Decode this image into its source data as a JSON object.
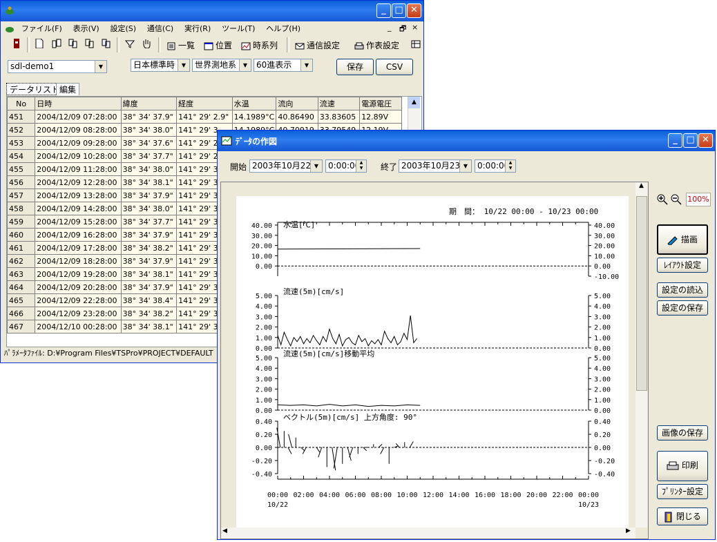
{
  "main": {
    "menu": [
      "ファイル(F)",
      "表示(V)",
      "設定(S)",
      "通信(C)",
      "実行(R)",
      "ツール(T)",
      "ヘルプ(H)"
    ],
    "mdi_controls": [
      "_",
      "🗗",
      "×"
    ],
    "toolbar": {
      "list_label": "一覧",
      "position_label": "位置",
      "timeseries_label": "時系列",
      "comm_settings_label": "通信設定",
      "table_settings_label": "作表設定"
    },
    "site_select": "sdl-demo1",
    "time_select": "日本標準時",
    "datum_select": "世界測地系",
    "format_select": "60進表示",
    "save_label": "保存",
    "csv_label": "CSV",
    "tabs": [
      "データリスト",
      "編集"
    ],
    "columns": [
      "No",
      "日時",
      "緯度",
      "経度",
      "水温",
      "流向",
      "流速",
      "電源電圧"
    ],
    "rows": [
      [
        "451",
        "2004/12/09 07:28:00",
        "38° 34' 37.9\"",
        "141° 29'  2.9\"",
        "14.1989°C",
        "40.86490",
        "33.83605",
        "12.89V"
      ],
      [
        "452",
        "2004/12/09 08:28:00",
        "38° 34' 38.0\"",
        "141° 29'  3.",
        "14.1989°C",
        "40.70919",
        "33.79549",
        "12.19V"
      ],
      [
        "453",
        "2004/12/09 09:28:00",
        "38° 34' 37.6\"",
        "141° 29'  2.",
        "",
        "",
        "",
        ""
      ],
      [
        "454",
        "2004/12/09 10:28:00",
        "38° 34' 37.7\"",
        "141° 29'  2.",
        "",
        "",
        "",
        ""
      ],
      [
        "455",
        "2004/12/09 11:28:00",
        "38° 34' 38.0\"",
        "141° 29'  3.",
        "",
        "",
        "",
        ""
      ],
      [
        "456",
        "2004/12/09 12:28:00",
        "38° 34' 38.1\"",
        "141° 29'  3.",
        "",
        "",
        "",
        ""
      ],
      [
        "457",
        "2004/12/09 13:28:00",
        "38° 34' 37.9\"",
        "141° 29'  3.",
        "",
        "",
        "",
        ""
      ],
      [
        "458",
        "2004/12/09 14:28:00",
        "38° 34' 38.0\"",
        "141° 29'  3.",
        "",
        "",
        "",
        ""
      ],
      [
        "459",
        "2004/12/09 15:28:00",
        "38° 34' 37.7\"",
        "141° 29'  3.",
        "",
        "",
        "",
        ""
      ],
      [
        "460",
        "2004/12/09 16:28:00",
        "38° 34' 37.9\"",
        "141° 29'  3.",
        "",
        "",
        "",
        ""
      ],
      [
        "461",
        "2004/12/09 17:28:00",
        "38° 34' 38.2\"",
        "141° 29'  3.",
        "",
        "",
        "",
        ""
      ],
      [
        "462",
        "2004/12/09 18:28:00",
        "38° 34' 37.9\"",
        "141° 29'  3.",
        "",
        "",
        "",
        ""
      ],
      [
        "463",
        "2004/12/09 19:28:00",
        "38° 34' 38.1\"",
        "141° 29'  3.",
        "",
        "",
        "",
        ""
      ],
      [
        "464",
        "2004/12/09 20:28:00",
        "38° 34' 37.9\"",
        "141° 29'  3.",
        "",
        "",
        "",
        ""
      ],
      [
        "465",
        "2004/12/09 22:28:00",
        "38° 34' 38.4\"",
        "141° 29'  3.",
        "",
        "",
        "",
        ""
      ],
      [
        "466",
        "2004/12/09 23:28:00",
        "38° 34' 38.2\"",
        "141° 29'  3.",
        "",
        "",
        "",
        ""
      ],
      [
        "467",
        "2004/12/10 00:28:00",
        "38° 34' 38.1\"",
        "141° 29'  3.",
        "",
        "",
        "",
        ""
      ]
    ],
    "status_text": "ﾊﾟﾗﾒｰﾀﾌｧｲﾙ: D:¥Program Files¥TSPro¥PROJECT¥DEFAULT"
  },
  "plot": {
    "title": "ﾃﾞｰﾀの作図",
    "start_label": "開始",
    "start_date": "2003年10月22日",
    "start_time": "0:00:00",
    "end_label": "終了",
    "end_date": "2003年10月23日",
    "end_time": "0:00:00",
    "zoom_value": "100%",
    "buttons": {
      "draw": "描画",
      "layout": "ﾚｲｱｳﾄ設定",
      "load": "設定の読込",
      "save_settings": "設定の保存",
      "save_image": "画像の保存",
      "print": "印刷",
      "printer": "ﾌﾟﾘﾝﾀｰ設定",
      "close": "閉じる"
    },
    "period_text": "期　間： 10/22 00:00 - 10/23 00:00",
    "x_ticks": [
      "00:00",
      "02:00",
      "04:00",
      "06:00",
      "08:00",
      "10:00",
      "12:00",
      "14:00",
      "16:00",
      "18:00",
      "20:00",
      "22:00",
      "00:00"
    ],
    "x_date_start": "10/22",
    "x_date_end": "10/23"
  },
  "chart_data": [
    {
      "type": "line",
      "title": "水温[℃]",
      "ylim": [
        -10,
        40
      ],
      "yticks_left": [
        "40.00",
        "30.00",
        "20.00",
        "10.00",
        "0.00"
      ],
      "yticks_right": [
        "40.00",
        "30.00",
        "20.00",
        "10.00",
        "0.00",
        "-10.00"
      ],
      "x": [
        0,
        11
      ],
      "values": [
        16.5,
        17.0
      ]
    },
    {
      "type": "line",
      "title": "流速(5m)[cm/s]",
      "ylim": [
        0,
        5
      ],
      "yticks_left": [
        "5.00",
        "4.00",
        "3.00",
        "2.00",
        "1.00",
        "0.00"
      ],
      "yticks_right": [
        "5.00",
        "4.00",
        "3.00",
        "2.00",
        "1.00",
        "0.00"
      ],
      "x": [
        0,
        0.25,
        0.5,
        0.75,
        1,
        1.25,
        1.5,
        1.75,
        2,
        2.25,
        2.5,
        2.75,
        3,
        3.25,
        3.5,
        3.75,
        4,
        4.25,
        4.5,
        4.75,
        5,
        5.25,
        5.5,
        5.75,
        6,
        6.25,
        6.5,
        6.75,
        7,
        7.25,
        7.5,
        7.75,
        8,
        8.25,
        8.5,
        8.75,
        9,
        9.25,
        9.5,
        9.75,
        10,
        10.25,
        10.5,
        10.75
      ],
      "values": [
        1.2,
        0.3,
        1.5,
        0.8,
        0.2,
        1.0,
        0.6,
        1.1,
        0.4,
        0.9,
        0.5,
        1.2,
        0.7,
        0.3,
        1.1,
        0.6,
        1.8,
        0.9,
        0.4,
        1.3,
        0.2,
        0.8,
        1.0,
        0.5,
        0.3,
        1.2,
        0.6,
        0.9,
        0.2,
        0.7,
        0.4,
        0.8,
        0.3,
        1.6,
        0.9,
        0.5,
        1.1,
        0.3,
        0.6,
        1.4,
        0.8,
        3.1,
        0.5,
        0.9
      ]
    },
    {
      "type": "line",
      "title": "流速(5m)[cm/s]移動平均",
      "ylim": [
        0,
        5
      ],
      "yticks_left": [
        "5.00",
        "4.00",
        "3.00",
        "2.00",
        "1.00",
        "0.00"
      ],
      "yticks_right": [
        "5.00",
        "4.00",
        "3.00",
        "2.00",
        "1.00",
        "0.00"
      ],
      "x": [
        0,
        1,
        2,
        3,
        4,
        5,
        6,
        7,
        8,
        9,
        10,
        11
      ],
      "values": [
        0.5,
        0.45,
        0.5,
        0.4,
        0.55,
        0.4,
        0.5,
        0.35,
        0.45,
        0.4,
        0.5,
        0.45
      ]
    },
    {
      "type": "scatter",
      "title": "ベクトル(5m)[cm/s]  上方角度: 90°",
      "ylim": [
        -0.4,
        0.4
      ],
      "yticks_left": [
        "0.40",
        "0.20",
        "0.00",
        "-0.20",
        "-0.40"
      ],
      "yticks_right": [
        "0.40",
        "0.20",
        "0.00",
        "-0.20",
        "-0.40"
      ],
      "x": [
        0.2,
        0.5,
        0.8,
        1.1,
        1.4,
        1.8,
        2.2,
        2.6,
        3.0,
        3.4,
        3.8,
        4.2,
        4.6,
        5.0,
        5.4,
        5.8,
        6.2,
        6.6,
        7.0,
        7.4,
        7.8,
        8.2,
        8.6,
        9.0,
        9.4,
        9.8,
        10.2
      ],
      "values": [
        0.3,
        0.25,
        -0.1,
        0.2,
        0.15,
        -0.05,
        -0.1,
        0.0,
        -0.08,
        -0.15,
        -0.3,
        -0.35,
        -0.32,
        -0.25,
        -0.2,
        -0.15,
        -0.1,
        -0.05,
        0.0,
        0.05,
        0.05,
        -0.1,
        -0.25,
        0.02,
        0.06,
        0.08,
        0.09
      ]
    }
  ]
}
